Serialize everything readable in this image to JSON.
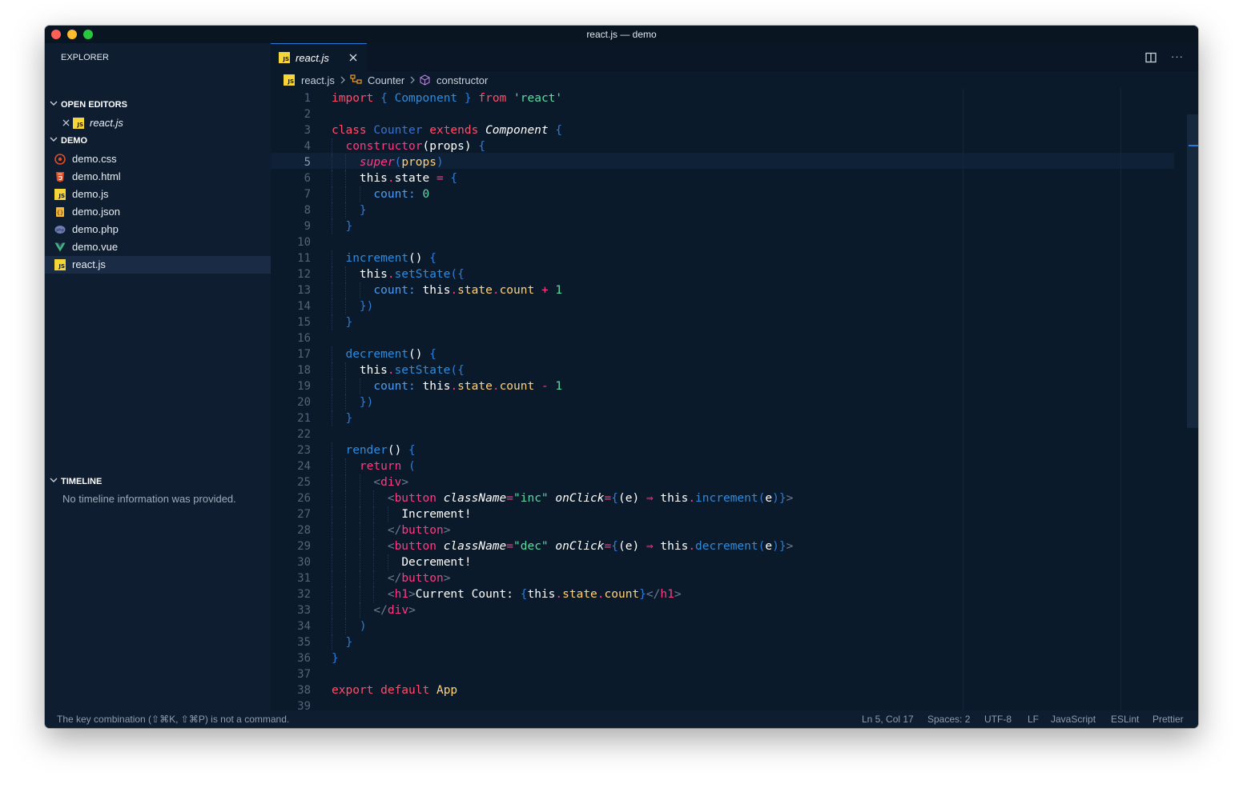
{
  "window": {
    "title": "react.js — demo"
  },
  "sidebar": {
    "title": "EXPLORER",
    "open_editors": {
      "label": "OPEN EDITORS",
      "items": [
        {
          "name": "react.js"
        }
      ]
    },
    "demo": {
      "label": "DEMO",
      "files": [
        {
          "name": "demo.css",
          "icon": "css-icon"
        },
        {
          "name": "demo.html",
          "icon": "html5-icon"
        },
        {
          "name": "demo.js",
          "icon": "js-icon"
        },
        {
          "name": "demo.json",
          "icon": "json-icon"
        },
        {
          "name": "demo.php",
          "icon": "php-icon"
        },
        {
          "name": "demo.vue",
          "icon": "vue-icon"
        },
        {
          "name": "react.js",
          "icon": "js-icon",
          "selected": true
        }
      ]
    },
    "timeline": {
      "label": "TIMELINE",
      "message": "No timeline information was provided."
    }
  },
  "tabs": [
    {
      "label": "react.js",
      "active": true
    }
  ],
  "breadcrumb": {
    "file": "react.js",
    "class": "Counter",
    "method": "constructor"
  },
  "editor": {
    "current_line": 5,
    "line_numbers": [
      "1",
      "2",
      "3",
      "4",
      "5",
      "6",
      "7",
      "8",
      "9",
      "10",
      "11",
      "12",
      "13",
      "14",
      "15",
      "16",
      "17",
      "18",
      "19",
      "20",
      "21",
      "22",
      "23",
      "24",
      "25",
      "26",
      "27",
      "28",
      "29",
      "30",
      "31",
      "32",
      "33",
      "34",
      "35",
      "36",
      "37",
      "38",
      "39"
    ],
    "lines": [
      [
        [
          "k",
          "import"
        ],
        [
          "p",
          " { "
        ],
        [
          "fn",
          "Component"
        ],
        [
          "p",
          " } "
        ],
        [
          "k",
          "from"
        ],
        [
          "s",
          " 'react'"
        ]
      ],
      [],
      [
        [
          "k",
          "class"
        ],
        [
          "cn",
          " Counter "
        ],
        [
          "k",
          "extends"
        ],
        [
          "at",
          " Component"
        ],
        [
          "p",
          " {"
        ]
      ],
      [
        [
          "t",
          "  "
        ],
        [
          "kp",
          "constructor"
        ],
        [
          "vr",
          "(props)"
        ],
        [
          "p",
          " {"
        ]
      ],
      [
        [
          "t",
          "    "
        ],
        [
          "kf",
          "super"
        ],
        [
          "p",
          "("
        ],
        [
          "ap",
          "props"
        ],
        [
          "p",
          ")"
        ]
      ],
      [
        [
          "t",
          "    "
        ],
        [
          "vr",
          "this"
        ],
        [
          "op",
          "."
        ],
        [
          "vr",
          "state"
        ],
        [
          "op",
          " ="
        ],
        [
          "p",
          " {"
        ]
      ],
      [
        [
          "t",
          "      "
        ],
        [
          "pr",
          "count:"
        ],
        [
          "n",
          " 0"
        ]
      ],
      [
        [
          "t",
          "    "
        ],
        [
          "p",
          "}"
        ]
      ],
      [
        [
          "t",
          "  "
        ],
        [
          "p",
          "}"
        ]
      ],
      [],
      [
        [
          "t",
          "  "
        ],
        [
          "fn",
          "increment"
        ],
        [
          "vr",
          "()"
        ],
        [
          "p",
          " {"
        ]
      ],
      [
        [
          "t",
          "    "
        ],
        [
          "vr",
          "this"
        ],
        [
          "op",
          "."
        ],
        [
          "fn",
          "setState"
        ],
        [
          "p",
          "({"
        ]
      ],
      [
        [
          "t",
          "      "
        ],
        [
          "pr",
          "count:"
        ],
        [
          "vr",
          " this"
        ],
        [
          "op",
          "."
        ],
        [
          "ap",
          "state"
        ],
        [
          "op",
          "."
        ],
        [
          "ap",
          "count"
        ],
        [
          "op",
          " +"
        ],
        [
          "n",
          " 1"
        ]
      ],
      [
        [
          "t",
          "    "
        ],
        [
          "p",
          "})"
        ]
      ],
      [
        [
          "t",
          "  "
        ],
        [
          "p",
          "}"
        ]
      ],
      [],
      [
        [
          "t",
          "  "
        ],
        [
          "fn",
          "decrement"
        ],
        [
          "vr",
          "()"
        ],
        [
          "p",
          " {"
        ]
      ],
      [
        [
          "t",
          "    "
        ],
        [
          "vr",
          "this"
        ],
        [
          "op",
          "."
        ],
        [
          "fn",
          "setState"
        ],
        [
          "p",
          "({"
        ]
      ],
      [
        [
          "t",
          "      "
        ],
        [
          "pr",
          "count:"
        ],
        [
          "vr",
          " this"
        ],
        [
          "op",
          "."
        ],
        [
          "ap",
          "state"
        ],
        [
          "op",
          "."
        ],
        [
          "ap",
          "count"
        ],
        [
          "op",
          " -"
        ],
        [
          "n",
          " 1"
        ]
      ],
      [
        [
          "t",
          "    "
        ],
        [
          "p",
          "})"
        ]
      ],
      [
        [
          "t",
          "  "
        ],
        [
          "p",
          "}"
        ]
      ],
      [],
      [
        [
          "t",
          "  "
        ],
        [
          "fn",
          "render"
        ],
        [
          "vr",
          "()"
        ],
        [
          "p",
          " {"
        ]
      ],
      [
        [
          "t",
          "    "
        ],
        [
          "kp",
          "return"
        ],
        [
          "p",
          " ("
        ]
      ],
      [
        [
          "t",
          "      "
        ],
        [
          "tb",
          "<"
        ],
        [
          "tg",
          "div"
        ],
        [
          "tb",
          ">"
        ]
      ],
      [
        [
          "t",
          "        "
        ],
        [
          "tb",
          "<"
        ],
        [
          "tg",
          "button"
        ],
        [
          "at",
          " className"
        ],
        [
          "op",
          "="
        ],
        [
          "s",
          "\"inc\""
        ],
        [
          "at",
          " onClick"
        ],
        [
          "op",
          "="
        ],
        [
          "p",
          "{"
        ],
        [
          "vr",
          "(e)"
        ],
        [
          "op",
          " ⇒ "
        ],
        [
          "vr",
          "this"
        ],
        [
          "op",
          "."
        ],
        [
          "fn",
          "increment"
        ],
        [
          "p",
          "("
        ],
        [
          "vr",
          "e"
        ],
        [
          "p",
          ")}"
        ],
        [
          "tb",
          ">"
        ]
      ],
      [
        [
          "t",
          "          "
        ],
        [
          "vr",
          "Increment!"
        ]
      ],
      [
        [
          "t",
          "        "
        ],
        [
          "tb",
          "</"
        ],
        [
          "tg",
          "button"
        ],
        [
          "tb",
          ">"
        ]
      ],
      [
        [
          "t",
          "        "
        ],
        [
          "tb",
          "<"
        ],
        [
          "tg",
          "button"
        ],
        [
          "at",
          " className"
        ],
        [
          "op",
          "="
        ],
        [
          "s",
          "\"dec\""
        ],
        [
          "at",
          " onClick"
        ],
        [
          "op",
          "="
        ],
        [
          "p",
          "{"
        ],
        [
          "vr",
          "(e)"
        ],
        [
          "op",
          " ⇒ "
        ],
        [
          "vr",
          "this"
        ],
        [
          "op",
          "."
        ],
        [
          "fn",
          "decrement"
        ],
        [
          "p",
          "("
        ],
        [
          "vr",
          "e"
        ],
        [
          "p",
          ")}"
        ],
        [
          "tb",
          ">"
        ]
      ],
      [
        [
          "t",
          "          "
        ],
        [
          "vr",
          "Decrement!"
        ]
      ],
      [
        [
          "t",
          "        "
        ],
        [
          "tb",
          "</"
        ],
        [
          "tg",
          "button"
        ],
        [
          "tb",
          ">"
        ]
      ],
      [
        [
          "t",
          "        "
        ],
        [
          "tb",
          "<"
        ],
        [
          "tg",
          "h1"
        ],
        [
          "tb",
          ">"
        ],
        [
          "vr",
          "Current Count: "
        ],
        [
          "p",
          "{"
        ],
        [
          "vr",
          "this"
        ],
        [
          "op",
          "."
        ],
        [
          "ap",
          "state"
        ],
        [
          "op",
          "."
        ],
        [
          "ap",
          "count"
        ],
        [
          "p",
          "}"
        ],
        [
          "tb",
          "</"
        ],
        [
          "tg",
          "h1"
        ],
        [
          "tb",
          ">"
        ]
      ],
      [
        [
          "t",
          "      "
        ],
        [
          "tb",
          "</"
        ],
        [
          "tg",
          "div"
        ],
        [
          "tb",
          ">"
        ]
      ],
      [
        [
          "t",
          "    "
        ],
        [
          "p",
          ")"
        ]
      ],
      [
        [
          "t",
          "  "
        ],
        [
          "p",
          "}"
        ]
      ],
      [
        [
          "p",
          "}"
        ]
      ],
      [],
      [
        [
          "k",
          "export"
        ],
        [
          "k",
          " default"
        ],
        [
          "ap",
          " App"
        ]
      ],
      []
    ]
  },
  "statusbar": {
    "message": "The key combination (⇧⌘K, ⇧⌘P) is not a command.",
    "position": "Ln 5, Col 17",
    "spaces": "Spaces: 2",
    "encoding": "UTF-8",
    "eol": "LF",
    "language": "JavaScript",
    "eslint": "ESLint",
    "prettier": "Prettier"
  },
  "colors": {
    "accent": "#2a7bd8",
    "background": "#0b1a2b",
    "sidebar": "#0e1d30"
  }
}
